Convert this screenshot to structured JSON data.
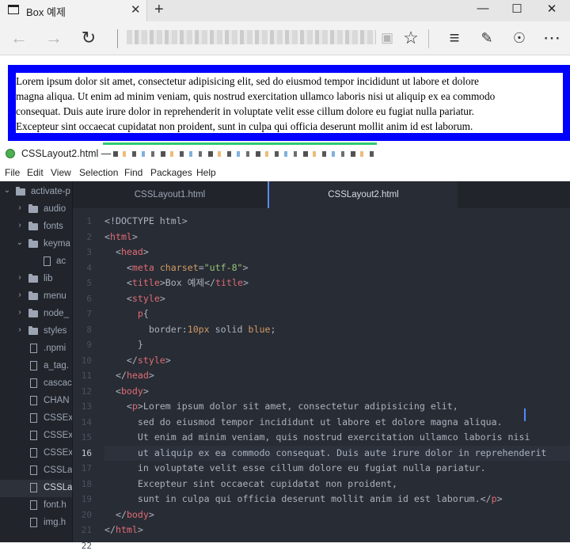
{
  "browser": {
    "tab_title": "Box 예제",
    "tab_close": "✕",
    "new_tab": "+",
    "controls": {
      "minimize": "—",
      "maximize": "☐",
      "close": "✕"
    },
    "nav_icons": [
      "back-arrow-icon",
      "forward-arrow-icon",
      "refresh-icon",
      "reading-view-icon",
      "favorite-star-icon",
      "hub-icon",
      "web-note-icon",
      "share-icon",
      "more-icon"
    ],
    "paragraph_lines": [
      "Lorem ipsum dolor sit amet, consectetur adipisicing elit, sed do eiusmod tempor incididunt ut labore et dolore",
      "magna aliqua. Ut enim ad minim veniam, quis nostrud exercitation ullamco laboris nisi ut aliquip ex ea commodo",
      "consequat. Duis aute irure dolor in reprehenderit in voluptate velit esse cillum dolore eu fugiat nulla pariatur.",
      "Excepteur sint occaecat cupidatat non proident, sunt in culpa qui officia deserunt mollit anim id est laborum."
    ],
    "paragraph_border_color": "#0000ff"
  },
  "atom": {
    "window_title": "CSSLayout2.html —",
    "menu": [
      "File",
      "Edit",
      "View",
      "Selection",
      "Find",
      "Packages",
      "Help"
    ],
    "tree": [
      {
        "label": "activate-p",
        "type": "folder",
        "state": "open"
      },
      {
        "label": "audio",
        "type": "folder",
        "state": "closed"
      },
      {
        "label": "fonts",
        "type": "folder",
        "state": "closed"
      },
      {
        "label": "keyma",
        "type": "folder",
        "state": "open"
      },
      {
        "label": "ac",
        "type": "file"
      },
      {
        "label": "lib",
        "type": "folder",
        "state": "closed"
      },
      {
        "label": "menu",
        "type": "folder",
        "state": "closed"
      },
      {
        "label": "node_",
        "type": "folder",
        "state": "closed"
      },
      {
        "label": "styles",
        "type": "folder",
        "state": "closed"
      },
      {
        "label": ".npmi",
        "type": "file"
      },
      {
        "label": "a_tag.",
        "type": "file"
      },
      {
        "label": "cascac",
        "type": "file"
      },
      {
        "label": "CHAN",
        "type": "file"
      },
      {
        "label": "CSSEx",
        "type": "file"
      },
      {
        "label": "CSSEx",
        "type": "file"
      },
      {
        "label": "CSSEx",
        "type": "file"
      },
      {
        "label": "CSSLa",
        "type": "file"
      },
      {
        "label": "CSSLa",
        "type": "file",
        "selected": true
      },
      {
        "label": "font.h",
        "type": "file"
      },
      {
        "label": "img.h",
        "type": "file"
      }
    ],
    "tabs": [
      "CSSLayout1.html",
      "CSSLayout2.html"
    ],
    "active_tab": "CSSLayout2.html",
    "current_line": 16,
    "code_lines": [
      "<!DOCTYPE html>",
      "<html>",
      "  <head>",
      "    <meta charset=\"utf-8\">",
      "    <title>Box 예제</title>",
      "    <style>",
      "      p{",
      "        border:10px solid blue;",
      "      }",
      "    </style>",
      "  </head>",
      "  <body>",
      "    <p>Lorem ipsum dolor sit amet, consectetur adipisicing elit,",
      "      sed do eiusmod tempor incididunt ut labore et dolore magna aliqua.",
      "      Ut enim ad minim veniam, quis nostrud exercitation ullamco laboris nisi",
      "      ut aliquip ex ea commodo consequat. Duis aute irure dolor in reprehenderit",
      "      in voluptate velit esse cillum dolore eu fugiat nulla pariatur.",
      "      Excepteur sint occaecat cupidatat non proident,",
      "      sunt in culpa qui officia deserunt mollit anim id est laborum.</p>",
      "  </body>",
      "</html>",
      ""
    ],
    "line_numbers": [
      "1",
      "2",
      "3",
      "4",
      "5",
      "6",
      "7",
      "8",
      "9",
      "10",
      "11",
      "12",
      "13",
      "14",
      "15",
      "16",
      "17",
      "18",
      "19",
      "20",
      "21",
      "22"
    ]
  }
}
